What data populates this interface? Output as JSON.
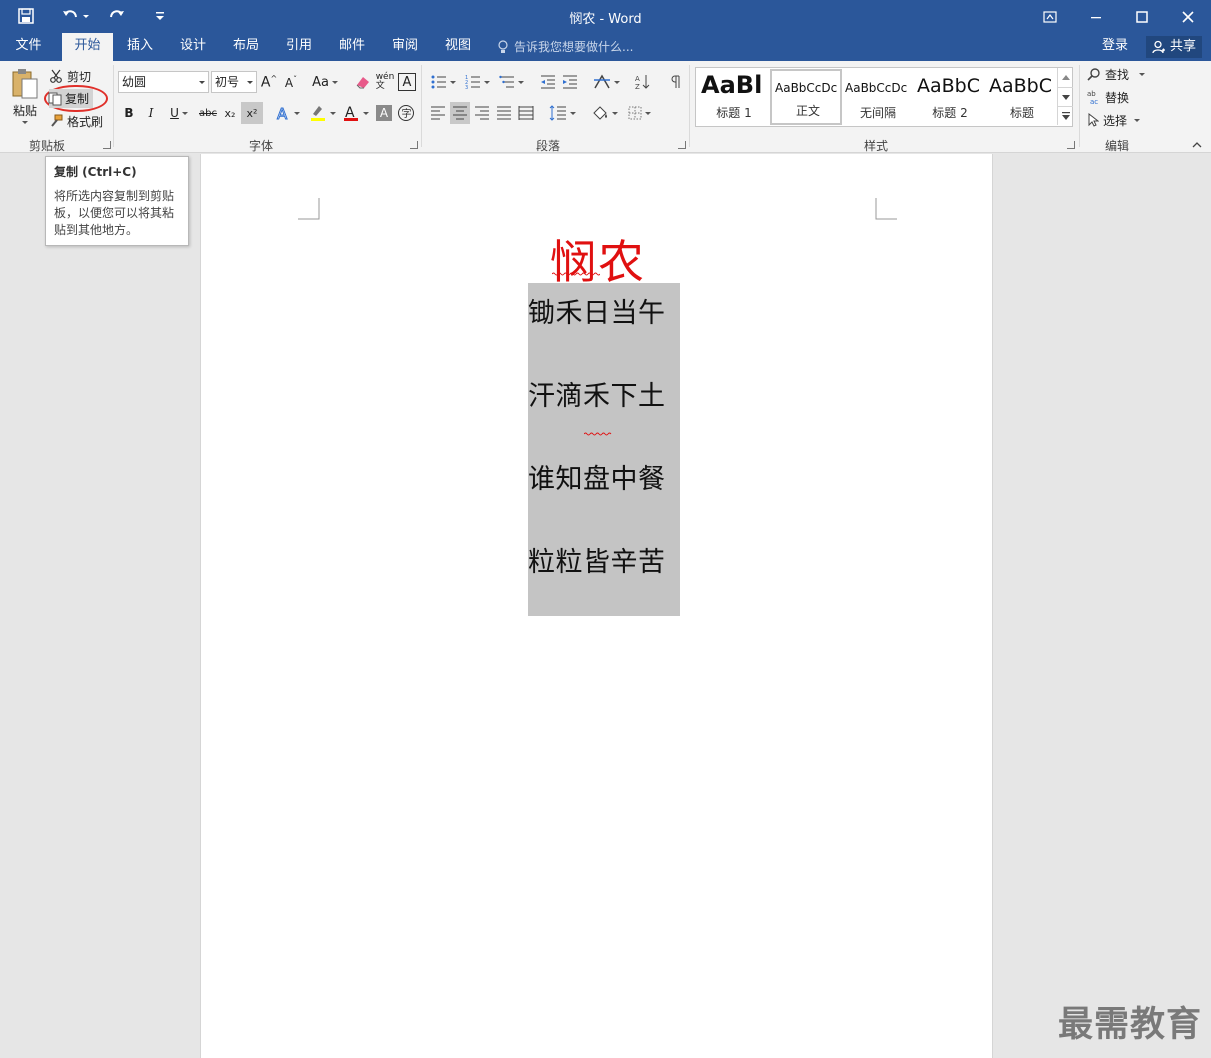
{
  "window": {
    "title": "悯农 - Word"
  },
  "tabs": [
    {
      "label": "文件"
    },
    {
      "label": "开始"
    },
    {
      "label": "插入"
    },
    {
      "label": "设计"
    },
    {
      "label": "布局"
    },
    {
      "label": "引用"
    },
    {
      "label": "邮件"
    },
    {
      "label": "审阅"
    },
    {
      "label": "视图"
    }
  ],
  "tellme": {
    "placeholder": "告诉我您想要做什么..."
  },
  "account": {
    "login": "登录",
    "share": "共享"
  },
  "clipboard": {
    "paste": "粘贴",
    "cut": "剪切",
    "copy": "复制",
    "format_painter": "格式刷",
    "group_label": "剪贴板"
  },
  "font": {
    "name": "幼圆",
    "size": "初号",
    "group_label": "字体",
    "bold": "B",
    "italic": "I",
    "underline": "U",
    "strike": "abc",
    "sub": "x₂",
    "sup": "x²",
    "highlight_color": "#ffff00",
    "font_color": "#e01010"
  },
  "paragraph": {
    "group_label": "段落"
  },
  "styles": {
    "group_label": "样式",
    "items": [
      {
        "preview": "AaBl",
        "name": "标题 1"
      },
      {
        "preview": "AaBbCcDc",
        "name": "正文"
      },
      {
        "preview": "AaBbCcDc",
        "name": "无间隔"
      },
      {
        "preview": "AaBbC",
        "name": "标题 2"
      },
      {
        "preview": "AaBbC",
        "name": "标题"
      }
    ]
  },
  "editing": {
    "find": "查找",
    "replace": "替换",
    "select": "选择",
    "group_label": "编辑"
  },
  "tooltip": {
    "title": "复制 (Ctrl+C)",
    "body": "将所选内容复制到剪贴板，以便您可以将其粘贴到其他地方。"
  },
  "document": {
    "title": "悯农",
    "lines": [
      "锄禾日当午",
      "汗滴禾下土",
      "谁知盘中餐",
      "粒粒皆辛苦"
    ]
  },
  "watermark": "最需教育",
  "colors": {
    "brand": "#2b579a",
    "ribbon": "#f3f3f3",
    "highlight_circle": "#e0302a"
  }
}
